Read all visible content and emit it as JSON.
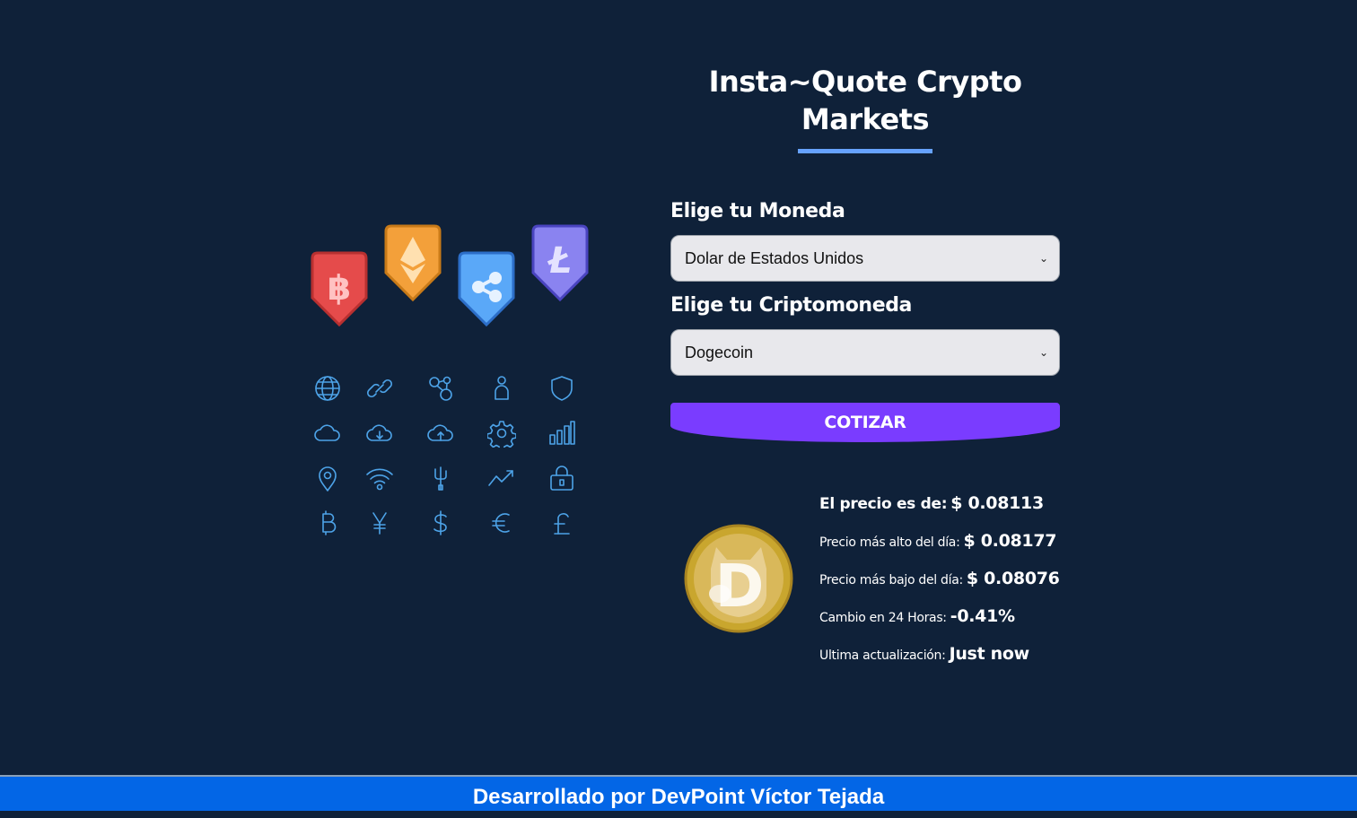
{
  "header": {
    "title": "Insta~Quote Crypto Markets"
  },
  "form": {
    "currency_label": "Elige tu Moneda",
    "currency_value": "Dolar de Estados Unidos",
    "crypto_label": "Elige tu Criptomoneda",
    "crypto_value": "Dogecoin",
    "submit_label": "COTIZAR"
  },
  "result": {
    "price_label": "El precio es de:",
    "price_value": "$ 0.08113",
    "high_label": "Precio más alto del día:",
    "high_value": "$ 0.08177",
    "low_label": "Precio más bajo del día:",
    "low_value": "$ 0.08076",
    "change_label": "Cambio en 24 Horas:",
    "change_value": "-0.41%",
    "updated_label": "Ultima actualización:",
    "updated_value": "Just now"
  },
  "footer": {
    "text": "Desarrollado por DevPoint Víctor Tejada"
  },
  "colors": {
    "background": "#0f2139",
    "accent_bar": "#66a2fe",
    "button": "#7a3cff",
    "footer": "#0366e6",
    "icon_stroke": "#4da3e8"
  },
  "icons": [
    "bitcoin-badge-icon",
    "ethereum-badge-icon",
    "ripple-badge-icon",
    "litecoin-badge-icon",
    "globe-icon",
    "link-icon",
    "network-icon",
    "user-icon",
    "shield-icon",
    "cloud-icon",
    "cloud-download-icon",
    "cloud-upload-icon",
    "gear-icon",
    "bar-chart-icon",
    "location-pin-icon",
    "wifi-icon",
    "usb-icon",
    "trend-up-icon",
    "lock-icon",
    "bitcoin-icon",
    "yen-icon",
    "dollar-icon",
    "euro-icon",
    "pound-icon"
  ]
}
